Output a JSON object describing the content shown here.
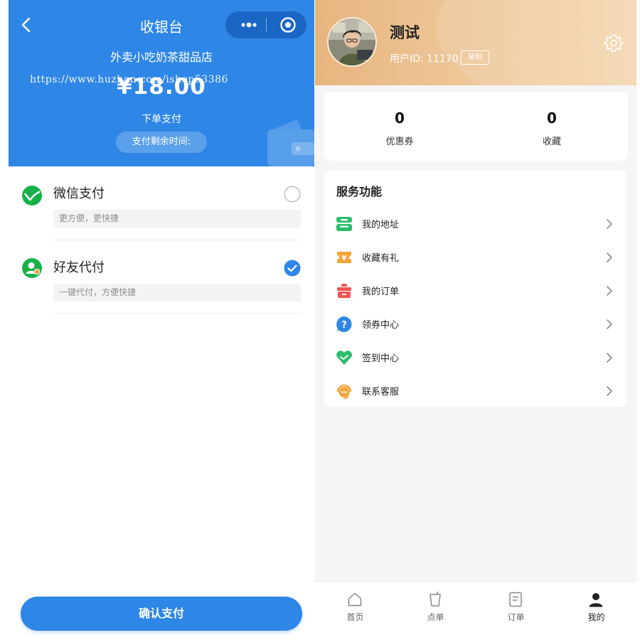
{
  "pay_page": {
    "nav_title": "收银台",
    "shop_name": "外卖小吃奶茶甜品店",
    "amount": "¥18.00",
    "watermark": "https://www.huzhan.com/ishop53386",
    "order_pay_label": "下单支付",
    "remaining_time_label": "支付剩余时间:",
    "options": [
      {
        "name": "微信支付",
        "desc": "更方便，更快捷",
        "selected": false,
        "icon": "wechat-pay-icon",
        "color": "#17b14a"
      },
      {
        "name": "好友代付",
        "desc": "一键代付，方便快捷",
        "selected": true,
        "icon": "friend-pay-icon",
        "color": "#17b14a"
      }
    ],
    "confirm_label": "确认支付",
    "accent_color": "#2e86e6"
  },
  "profile_page": {
    "user_name": "测试",
    "user_id": "用户ID: 11170",
    "copy_label": "复制",
    "stats": [
      {
        "value": "0",
        "label": "优惠券"
      },
      {
        "value": "0",
        "label": "收藏"
      }
    ],
    "service_title": "服务功能",
    "services": [
      {
        "label": "我的地址",
        "icon": "address-icon",
        "color": "#2bbd6a"
      },
      {
        "label": "收藏有礼",
        "icon": "gift-coupon-icon",
        "color": "#f3a53a"
      },
      {
        "label": "我的订单",
        "icon": "order-box-icon",
        "color": "#f05454"
      },
      {
        "label": "领券中心",
        "icon": "help-bubble-icon",
        "color": "#2e86e6"
      },
      {
        "label": "签到中心",
        "icon": "check-in-heart-icon",
        "color": "#2bbd6a"
      },
      {
        "label": "联系客服",
        "icon": "customer-service-icon",
        "color": "#f3a53a"
      }
    ],
    "tabs": [
      {
        "label": "首页",
        "icon": "home-icon",
        "active": false
      },
      {
        "label": "点单",
        "icon": "cup-icon",
        "active": false
      },
      {
        "label": "订单",
        "icon": "order-list-icon",
        "active": false
      },
      {
        "label": "我的",
        "icon": "profile-icon",
        "active": true
      }
    ],
    "header_color": "#e7b57f"
  }
}
